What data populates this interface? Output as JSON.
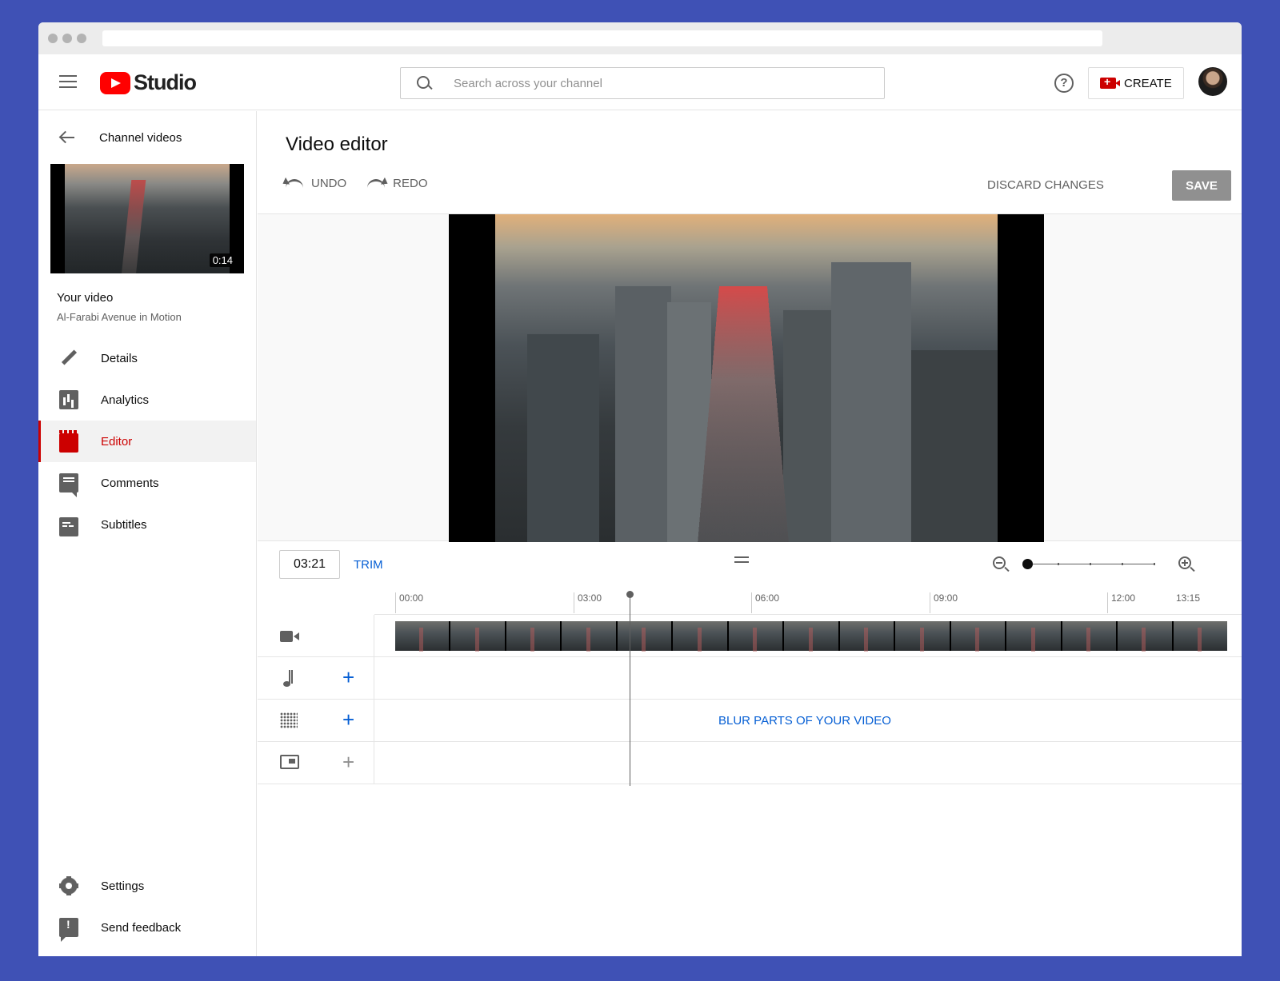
{
  "header": {
    "logo_text": "Studio",
    "search_placeholder": "Search across your channel",
    "create_label": "CREATE"
  },
  "sidebar": {
    "back_label": "Channel videos",
    "video_duration": "0:14",
    "your_video_label": "Your video",
    "video_title": "Al-Farabi Avenue in Motion",
    "items": [
      {
        "label": "Details",
        "icon": "pencil-icon"
      },
      {
        "label": "Analytics",
        "icon": "analytics-icon"
      },
      {
        "label": "Editor",
        "icon": "editor-icon",
        "active": true
      },
      {
        "label": "Comments",
        "icon": "comments-icon"
      },
      {
        "label": "Subtitles",
        "icon": "subtitles-icon"
      }
    ],
    "bottom_items": [
      {
        "label": "Settings",
        "icon": "gear-icon"
      },
      {
        "label": "Send feedback",
        "icon": "feedback-icon"
      }
    ]
  },
  "editor": {
    "title": "Video editor",
    "undo_label": "UNDO",
    "redo_label": "REDO",
    "discard_label": "DISCARD CHANGES",
    "save_label": "SAVE",
    "current_time": "03:21",
    "trim_label": "TRIM",
    "zoom_level": 0,
    "ruler_ticks": [
      "00:00",
      "03:00",
      "06:00",
      "09:00",
      "12:00",
      "13:15"
    ],
    "blur_label": "BLUR PARTS OF YOUR VIDEO",
    "accent_color": "#065fd4",
    "brand_color": "#cc0000"
  }
}
